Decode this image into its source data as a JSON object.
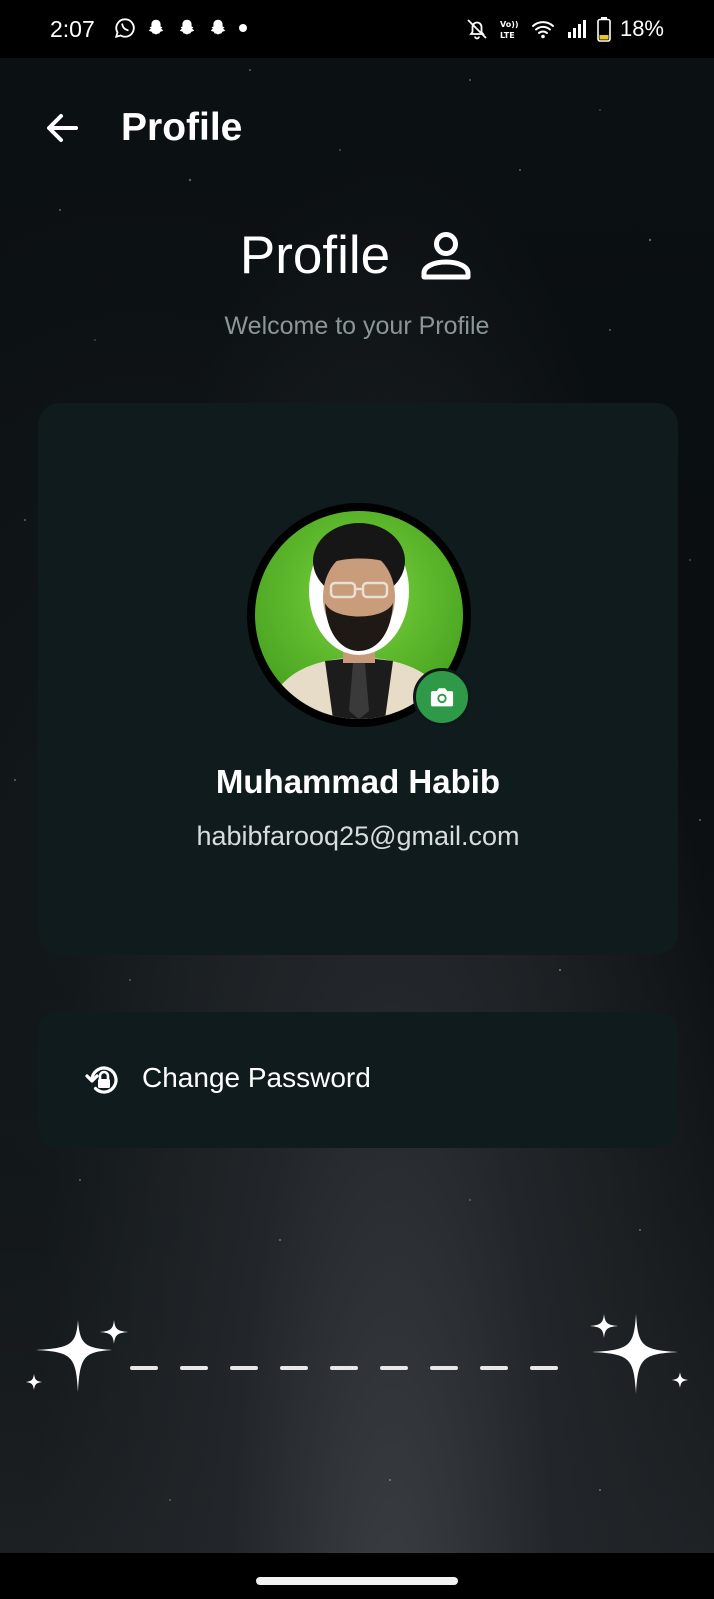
{
  "status_bar": {
    "time": "2:07",
    "battery": "18%",
    "left_icons": [
      "whatsapp-icon",
      "snapchat-icon",
      "snapchat-icon",
      "snapchat-icon",
      "dot-icon"
    ],
    "right_icons": [
      "bell-off-icon",
      "volte-icon",
      "wifi-icon",
      "signal-icon",
      "battery-icon"
    ]
  },
  "app_bar": {
    "title": "Profile",
    "back_icon": "arrow-back-icon"
  },
  "header": {
    "heading": "Profile",
    "heading_icon": "person-icon",
    "subtitle": "Welcome to your Profile"
  },
  "profile": {
    "name": "Muhammad Habib",
    "email": "habibfarooq25@gmail.com",
    "camera_icon": "camera-icon"
  },
  "actions": {
    "change_password_label": "Change Password",
    "change_password_icon": "lock-reset-icon"
  },
  "colors": {
    "card": "#101b1e",
    "accent_green": "#2e9a47",
    "subtitle": "#8c9598"
  }
}
